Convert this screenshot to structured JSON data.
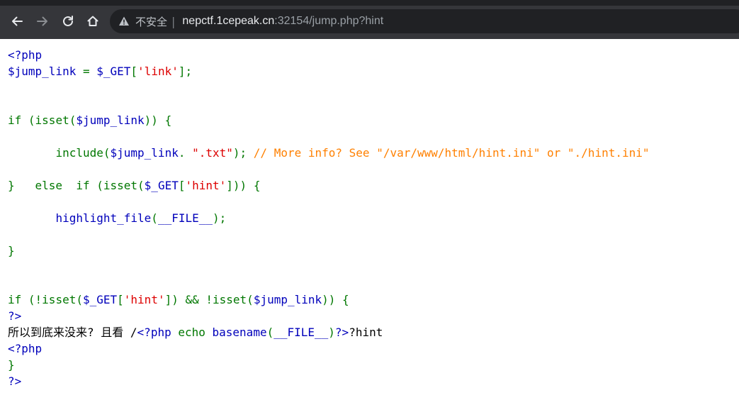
{
  "browser": {
    "back_icon": "arrow-left-icon",
    "forward_icon": "arrow-right-icon",
    "reload_icon": "reload-icon",
    "home_icon": "home-icon",
    "security_label": "不安全",
    "url_host": "nepctf.1cepeak.cn",
    "url_rest": ":32154/jump.php?hint"
  },
  "colors": {
    "default": "#0000BB",
    "keyword": "#007700",
    "string": "#DD0000",
    "comment": "#FF8000",
    "html": "#000000"
  },
  "source": {
    "l1": {
      "t0": "<?php"
    },
    "l2": {
      "t0": "$jump_link ",
      "t1": "= ",
      "t2": "$_GET",
      "t3": "[",
      "t4": "'link'",
      "t5": "];"
    },
    "l5": {
      "t0": "if ",
      "t1": "(isset(",
      "t2": "$jump_link",
      "t3": ")) ",
      "t4": "{"
    },
    "l7": {
      "indent": "       ",
      "t0": "include(",
      "t1": "$jump_link",
      "t2": ". ",
      "t3": "\".txt\"",
      "t4": "); ",
      "t5": "// More info? See \"/var/www/html/hint.ini\" or \"./hint.ini\""
    },
    "l9": {
      "t0": "}   else  if ",
      "t1": "(isset(",
      "t2": "$_GET",
      "t3": "[",
      "t4": "'hint'",
      "t5": "])) ",
      "t6": "{"
    },
    "l11": {
      "indent": "       ",
      "t0": "highlight_file",
      "t1": "(",
      "t2": "__FILE__",
      "t3": ");"
    },
    "l13": {
      "t0": "}"
    },
    "l16": {
      "t0": "if ",
      "t1": "(!isset(",
      "t2": "$_GET",
      "t3": "[",
      "t4": "'hint'",
      "t5": "]) && !isset(",
      "t6": "$jump_link",
      "t7": ")) ",
      "t8": "{"
    },
    "l17": {
      "t0": "?>"
    },
    "l18": {
      "t0": "所以到底来没来? 且看 /",
      "t1": "<?php ",
      "t2": "echo ",
      "t3": "basename",
      "t4": "(",
      "t5": "__FILE__",
      "t6": ")",
      "t7": "?>",
      "t8": "?hint"
    },
    "l19": {
      "t0": "<?php"
    },
    "l20": {
      "t0": "}"
    },
    "l21": {
      "t0": "?>"
    }
  }
}
